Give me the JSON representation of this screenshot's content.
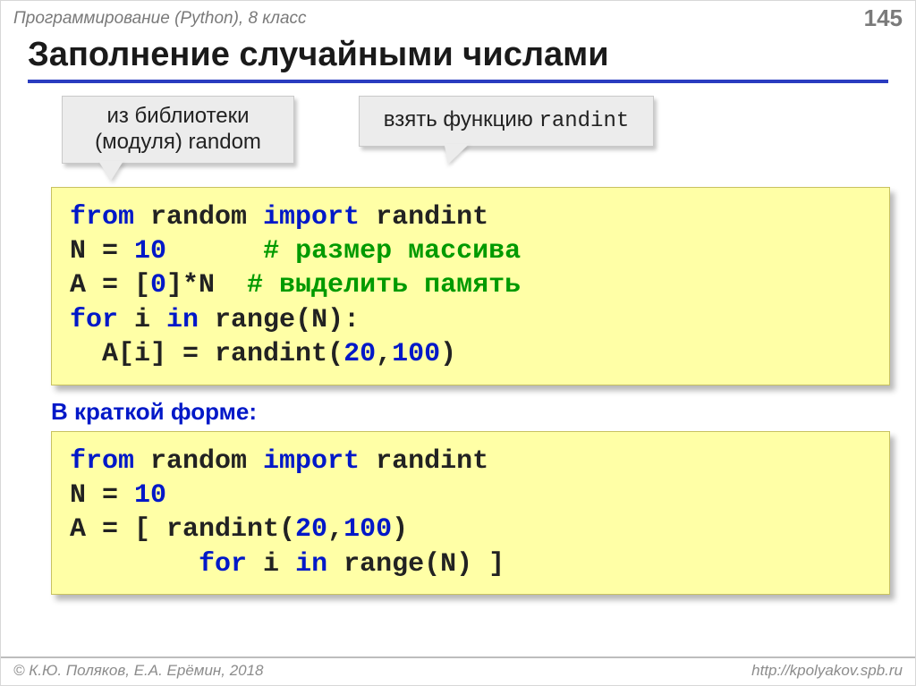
{
  "header": {
    "course": "Программирование (Python), 8 класс",
    "page": "145"
  },
  "title": "Заполнение случайными числами",
  "callouts": {
    "c1_line1": "из библиотеки",
    "c1_line2": "(модуля) random",
    "c2_text": "взять функцию ",
    "c2_mono": "randint"
  },
  "code1": {
    "l1a": "from",
    "l1b": " random ",
    "l1c": "import",
    "l1d": " randint",
    "l2a": "N = ",
    "l2b": "10",
    "l2c": "      ",
    "l2d": "# размер массива",
    "l3a": "A = [",
    "l3b": "0",
    "l3c": "]*N  ",
    "l3d": "# выделить память",
    "l4a": "for",
    "l4b": " i ",
    "l4c": "in",
    "l4d": " range(N):",
    "l5a": "  A[i] = randint(",
    "l5b": "20",
    "l5c": ",",
    "l5d": "100",
    "l5e": ")"
  },
  "subhead": "В краткой форме:",
  "code2": {
    "l1a": "from",
    "l1b": " random ",
    "l1c": "import",
    "l1d": " randint",
    "l2a": "N = ",
    "l2b": "10",
    "l3a": "A = [ randint(",
    "l3b": "20",
    "l3c": ",",
    "l3d": "100",
    "l3e": ") ",
    "l4a": "        ",
    "l4b": "for",
    "l4c": " i ",
    "l4d": "in",
    "l4e": " range(N) ]"
  },
  "footer": {
    "left": "© К.Ю. Поляков, Е.А. Ерёмин, 2018",
    "right": "http://kpolyakov.spb.ru"
  }
}
